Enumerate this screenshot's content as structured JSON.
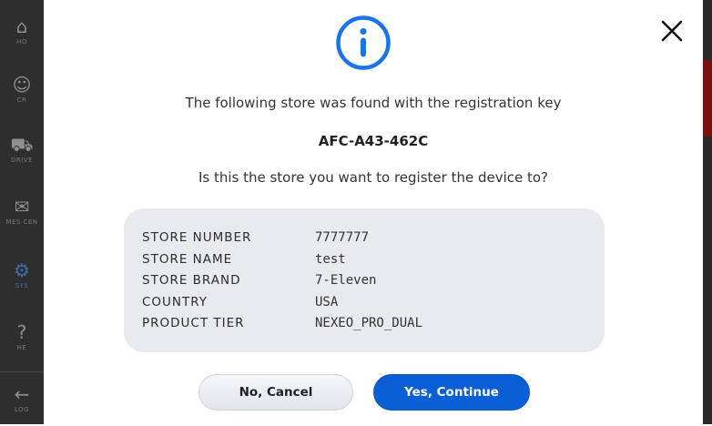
{
  "background_app": {
    "sidebar": [
      {
        "label": "HO",
        "icon": "home-icon",
        "glyph": "⌂"
      },
      {
        "label": "CR",
        "icon": "user-icon",
        "glyph": "☺"
      },
      {
        "label": "DRIVE",
        "icon": "car-icon",
        "glyph": "⛟"
      },
      {
        "label": "MES CEN",
        "icon": "message-center-icon",
        "glyph": "✉"
      },
      {
        "label": "SYS",
        "icon": "gear-icon",
        "glyph": "⚙"
      },
      {
        "label": "HE",
        "icon": "help-icon",
        "glyph": "?"
      },
      {
        "label": "LOG",
        "icon": "logout-icon",
        "glyph": "←"
      }
    ]
  },
  "modal": {
    "icon": "info-icon",
    "message_line1": "The following store was found with the registration key",
    "registration_key": "AFC-A43-462C",
    "question": "Is this the store you want to register the device to?",
    "details": [
      {
        "label": "STORE NUMBER",
        "value": "7777777"
      },
      {
        "label": "STORE NAME",
        "value": "test"
      },
      {
        "label": "STORE BRAND",
        "value": "7-Eleven"
      },
      {
        "label": "COUNTRY",
        "value": "USA"
      },
      {
        "label": "PRODUCT TIER",
        "value": "NEXEO_PRO_DUAL"
      }
    ],
    "cancel_label": "No, Cancel",
    "continue_label": "Yes, Continue"
  },
  "colors": {
    "accent": "#0b5fd6",
    "info_icon": "#1a73e8",
    "details_bg": "#e9eaee"
  }
}
